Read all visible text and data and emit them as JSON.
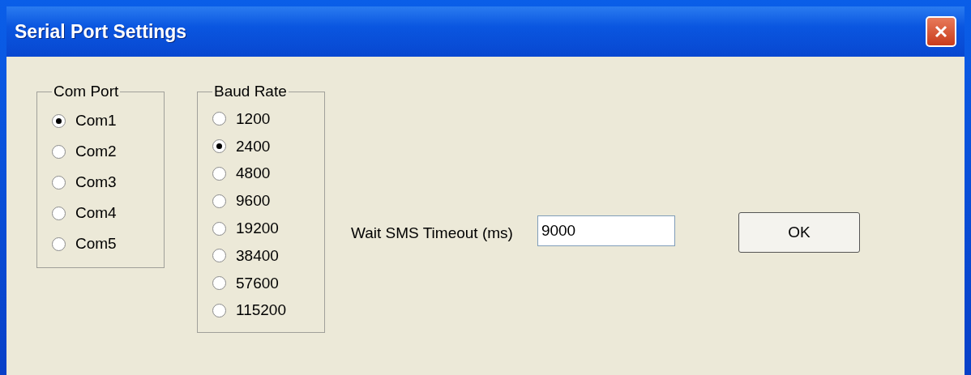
{
  "window": {
    "title": "Serial Port Settings"
  },
  "com_port": {
    "title": "Com Port",
    "options": [
      {
        "label": "Com1",
        "selected": true
      },
      {
        "label": "Com2",
        "selected": false
      },
      {
        "label": "Com3",
        "selected": false
      },
      {
        "label": "Com4",
        "selected": false
      },
      {
        "label": "Com5",
        "selected": false
      }
    ]
  },
  "baud_rate": {
    "title": "Baud Rate",
    "options": [
      {
        "label": "1200",
        "selected": false
      },
      {
        "label": "2400",
        "selected": true
      },
      {
        "label": "4800",
        "selected": false
      },
      {
        "label": "9600",
        "selected": false
      },
      {
        "label": "19200",
        "selected": false
      },
      {
        "label": "38400",
        "selected": false
      },
      {
        "label": "57600",
        "selected": false
      },
      {
        "label": "115200",
        "selected": false
      }
    ]
  },
  "timeout": {
    "label": "Wait SMS Timeout (ms)",
    "value": "9000"
  },
  "buttons": [
    "OK"
  ]
}
